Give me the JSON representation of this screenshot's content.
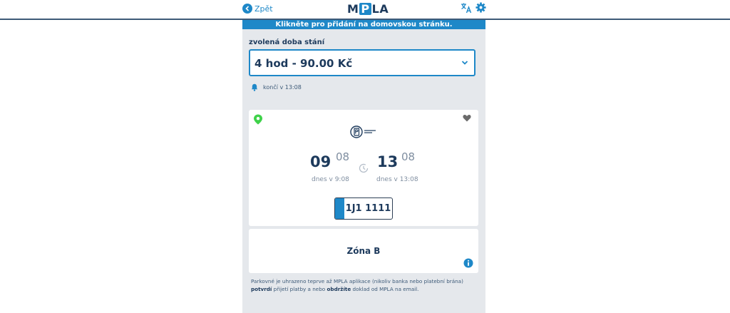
{
  "header": {
    "back_label": "Zpět",
    "logo_left": "M",
    "logo_p": "P",
    "logo_right": "LA"
  },
  "banner": {
    "text": "Klikněte pro přidání na domovskou stránku."
  },
  "duration": {
    "label": "zvolená doba stání",
    "selected": "4 hod - 90.00 Kč",
    "ends_text": "končí v 13:08"
  },
  "ticket": {
    "start_hour": "09",
    "start_min": "08",
    "start_sub": "dnes v 9:08",
    "end_hour": "13",
    "end_min": "08",
    "end_sub": "dnes v 13:08",
    "plate": "1J1 1111"
  },
  "zone": {
    "name": "Zóna B"
  },
  "disclaimer": {
    "part1": "Parkovné je uhrazeno teprve až MPLA aplikace (nikoliv banka nebo platební brána) ",
    "bold1": "potvrdí",
    "part2": " přijetí platby a nebo ",
    "bold2": "obdržíte",
    "part3": " doklad od MPLA na email."
  },
  "colors": {
    "accent": "#1e88c8",
    "dark": "#1d3a5c",
    "muted": "#7f8ea0",
    "background": "#e5e8ec",
    "pin": "#3fd24a"
  },
  "icons": [
    "back-icon",
    "translate-icon",
    "gear-icon",
    "chevron-down-icon",
    "bell-icon",
    "location-pin-icon",
    "heart-icon",
    "parking-logo-icon",
    "clock-icon",
    "info-icon"
  ]
}
